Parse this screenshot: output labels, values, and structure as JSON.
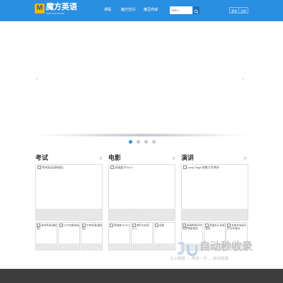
{
  "header": {
    "logo_letter": "M",
    "brand": "魔方英语",
    "brand_sub": "MOFUN ENGLISH",
    "nav": [
      "课程",
      "魔方空间",
      "魔豆商城"
    ],
    "search": {
      "placeholder": "请输入..."
    },
    "login": "登录",
    "register": "注册"
  },
  "carousel": {
    "prev": "‹",
    "next": "›",
    "dots": 4,
    "active_index": 0
  },
  "sections": [
    {
      "title": "考试",
      "more": "›",
      "featured": {
        "alt": "考研英语(基础班)",
        "caption": "考研英语(基础班)"
      },
      "items": [
        {
          "alt": "高考英语(基础班)",
          "caption": "高考英语(基础班)"
        },
        {
          "alt": "CET6(基础班)",
          "caption": "CET6(基础班)"
        },
        {
          "alt": "中考英语(基础班)",
          "caption": "中考英语(基础班)"
        }
      ]
    },
    {
      "title": "电影",
      "more": "›",
      "featured": {
        "alt": "英雄盒子Vol.3",
        "caption": "英雄盒子Vol.8"
      },
      "items": [
        {
          "alt": "英雄盒子Vol.1",
          "caption": "英雄盒子Vol.1"
        },
        {
          "alt": "星际大机密(一)",
          "caption": "星际大机密"
        },
        {
          "alt": "成星",
          "caption": "成星：下游"
        }
      ]
    },
    {
      "title": "演讲",
      "more": "›",
      "featured": {
        "alt": "Lady Gaga 耶鲁大学演讲",
        "caption": "Lady Gaga 耶鲁大学演讲"
      },
      "items": [
        {
          "alt": "泰勒斯蒂芬特别思想家演讲",
          "caption": "泰勒斯蒂芬"
        },
        {
          "alt": "英国女王圣诞演讲",
          "caption": "英国女王"
        },
        {
          "alt": "圣雄甘地诺贝尔大学演讲",
          "caption": "圣雄甘地"
        }
      ]
    }
  ],
  "watermark": {
    "text": "自动秒收录",
    "sub": "以上链接 → 来访一次 → 自动收录"
  },
  "colors": {
    "header": "#2a8fe0",
    "accent": "#2a8fe0",
    "footer": "#3d3d3d"
  }
}
